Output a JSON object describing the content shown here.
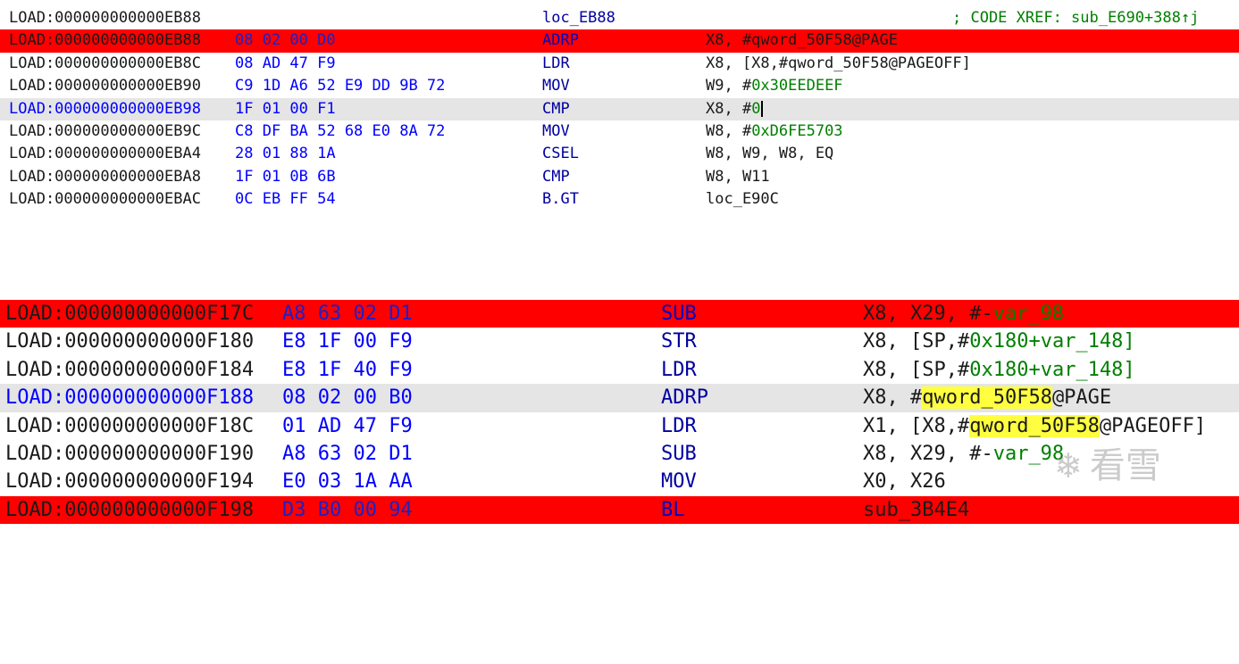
{
  "top_listing": {
    "label_row": {
      "address": "LOAD:000000000000EB88",
      "label": "loc_EB88",
      "xref": "; CODE XREF: sub_E690+388↑j"
    },
    "rows": [
      {
        "address": "LOAD:000000000000EB88",
        "bytes": "08 02 00 D0",
        "mnemonic": "ADRP",
        "operands": "X8, #qword_50F58@PAGE",
        "highlight": "red"
      },
      {
        "address": "LOAD:000000000000EB8C",
        "bytes": "08 AD 47 F9",
        "mnemonic": "LDR",
        "operands": "X8, [X8,#qword_50F58@PAGEOFF]"
      },
      {
        "address": "LOAD:000000000000EB90",
        "bytes": "C9 1D A6 52 E9 DD 9B 72",
        "mnemonic": "MOV",
        "operands_pre": "W9, #",
        "operands_num": "0x30EEDEEF"
      },
      {
        "address": "LOAD:000000000000EB98",
        "bytes": "1F 01 00 F1",
        "mnemonic": "CMP",
        "operands_pre": "X8, #",
        "operands_num": "0",
        "highlight": "gray",
        "cursor": true
      },
      {
        "address": "LOAD:000000000000EB9C",
        "bytes": "C8 DF BA 52 68 E0 8A 72",
        "mnemonic": "MOV",
        "operands_pre": "W8, #",
        "operands_num": "0xD6FE5703"
      },
      {
        "address": "LOAD:000000000000EBA4",
        "bytes": "28 01 88 1A",
        "mnemonic": "CSEL",
        "operands": "W8, W9, W8, EQ"
      },
      {
        "address": "LOAD:000000000000EBA8",
        "bytes": "1F 01 0B 6B",
        "mnemonic": "CMP",
        "operands": "W8, W11"
      },
      {
        "address": "LOAD:000000000000EBAC",
        "bytes": "0C EB FF 54",
        "mnemonic": "B.GT",
        "operands": "loc_E90C"
      }
    ]
  },
  "bottom_listing": {
    "rows": [
      {
        "address": "LOAD:000000000000F17C",
        "bytes": "A8 63 02 D1",
        "mnemonic": "SUB",
        "operands_pre": "X8, X29, #-",
        "operands_num": "var_98",
        "highlight": "red"
      },
      {
        "address": "LOAD:000000000000F180",
        "bytes": "E8 1F 00 F9",
        "mnemonic": "STR",
        "operands_pre": "X8, [SP,#",
        "operands_num": "0x180",
        "operands_post": "+var_148]"
      },
      {
        "address": "LOAD:000000000000F184",
        "bytes": "E8 1F 40 F9",
        "mnemonic": "LDR",
        "operands_pre": "X8, [SP,#",
        "operands_num": "0x180",
        "operands_post": "+var_148]"
      },
      {
        "address": "LOAD:000000000000F188",
        "bytes": "08 02 00 B0",
        "mnemonic": "ADRP",
        "operands_pre": "X8, #",
        "operands_hl": "qword_50F58",
        "operands_post": "@PAGE",
        "highlight": "gray"
      },
      {
        "address": "LOAD:000000000000F18C",
        "bytes": "01 AD 47 F9",
        "mnemonic": "LDR",
        "operands_pre": "X1, [X8,#",
        "operands_hl": "qword_50F58",
        "operands_post": "@PAGEOFF]"
      },
      {
        "address": "LOAD:000000000000F190",
        "bytes": "A8 63 02 D1",
        "mnemonic": "SUB",
        "operands_pre": "X8, X29, #-",
        "operands_num": "var_98"
      },
      {
        "address": "LOAD:000000000000F194",
        "bytes": "E0 03 1A AA",
        "mnemonic": "MOV",
        "operands": "X0, X26"
      },
      {
        "address": "LOAD:000000000000F198",
        "bytes": "D3 B0 00 94",
        "mnemonic": "BL",
        "operands": "sub_3B4E4",
        "highlight": "red"
      }
    ]
  },
  "watermark": {
    "text": "看雪",
    "icon": "snowflake-icon"
  },
  "colors": {
    "breakpoint": "#ff0000",
    "current_line": "#e5e5e5",
    "highlight": "#ffff40",
    "bytes": "#0000ff",
    "number": "#008000"
  }
}
